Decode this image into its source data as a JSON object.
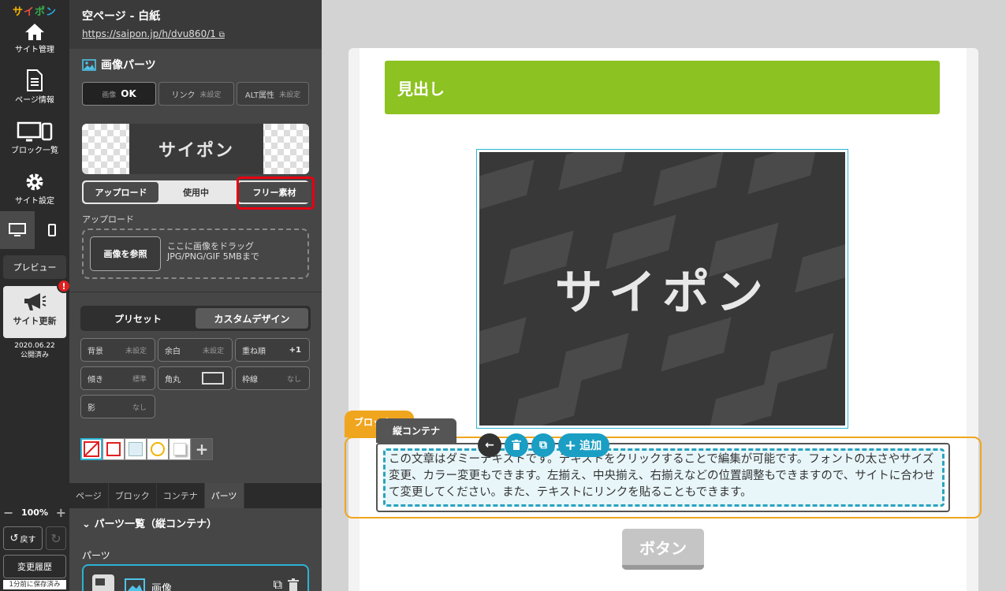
{
  "nav": {
    "logo_chars": [
      "サ",
      "イ",
      "ポ",
      "ン"
    ],
    "site_manage": "サイト管理",
    "page_info": "ページ情報",
    "block_list": "ブロック一覧",
    "site_settings": "サイト設定",
    "preview": "プレビュー",
    "site_update": "サイト更新",
    "update_badge": "!",
    "update_date": "2020.06.22",
    "update_status": "公開済み",
    "zoom": "100%",
    "undo": "戻す",
    "history": "変更履歴",
    "saved_note": "1分前に保存済み"
  },
  "panel": {
    "page_title": "空ページ - 白紙",
    "page_url": "https://saipon.jp/h/dvu860/1",
    "section_title": "画像パーツ",
    "img_btn": {
      "label": "画像",
      "value": "OK"
    },
    "link_btn": {
      "label": "リンク",
      "value": "未設定"
    },
    "alt_btn": {
      "label": "ALT属性",
      "value": "未設定"
    },
    "preview_text": "サイポン",
    "source_tabs": [
      "アップロード",
      "使用中",
      "フリー素材"
    ],
    "upload_label": "アップロード",
    "browse": "画像を参照",
    "drop_hint_1": "ここに画像をドラッグ",
    "drop_hint_2": "JPG/PNG/GIF 5MBまで",
    "design_tabs": [
      "プリセット",
      "カスタムデザイン"
    ],
    "props": [
      {
        "label": "背景",
        "value": "未設定"
      },
      {
        "label": "余白",
        "value": "未設定"
      },
      {
        "label": "重ね順",
        "value": "+1"
      },
      {
        "label": "傾き",
        "value": "標準"
      },
      {
        "label": "角丸",
        "value": ""
      },
      {
        "label": "枠線",
        "value": "なし"
      },
      {
        "label": "影",
        "value": "なし"
      }
    ],
    "bottom_tabs": [
      "ページ",
      "ブロック",
      "コンテナ",
      "パーツ"
    ],
    "parts_list_title": "パーツ一覧（縦コンテナ）",
    "parts_label": "パーツ",
    "part_name": "画像"
  },
  "canvas": {
    "heading": "見出し",
    "image_text": "サイポン",
    "block_tag": "ブロック",
    "container_tag": "縦コンテナ",
    "add_label": "追加",
    "body_text": "この文章はダミーテキストです。テキストをクリックすることで編集が可能です。フォントの太さやサイズ変更、カラー変更もできます。左揃え、中央揃え、右揃えなどの位置調整もできますので、サイトに合わせて変更してください。また、テキストにリンクを貼ることもできます。",
    "button": "ボタン"
  },
  "colors": {
    "accent": "#2bb3d4",
    "heading_bg": "#8cc221",
    "block_outline": "#f0a51e",
    "highlight": "#e60012"
  }
}
